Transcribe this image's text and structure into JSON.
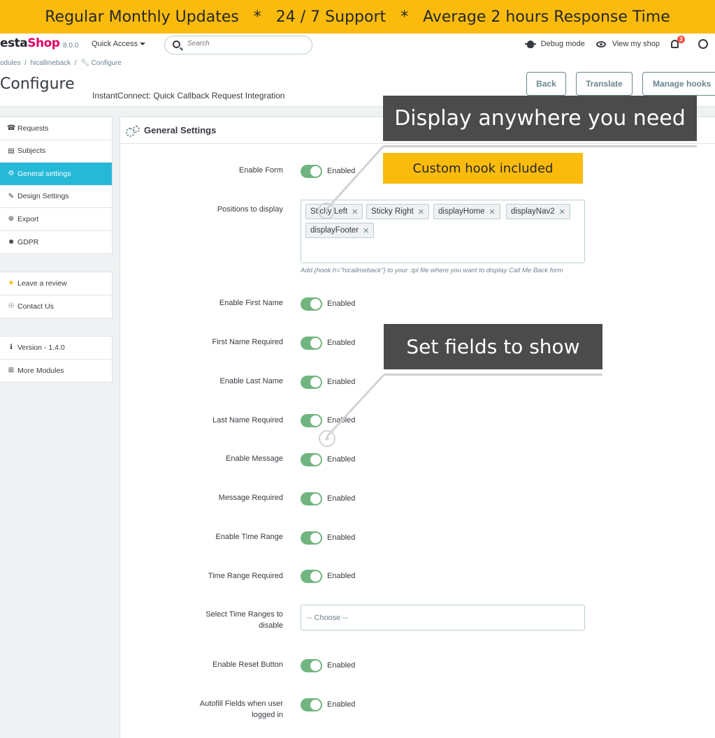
{
  "banner": {
    "text": "Regular Monthly Updates   *   24 / 7 Support   *   Average 2 hours Response Time"
  },
  "topbar": {
    "logo_prefix": "esta",
    "logo_suffix": "Shop",
    "version": "8.0.0",
    "quick_access": "Quick Access",
    "search_placeholder": "Search",
    "debug_mode": "Debug mode",
    "view_shop": "View my shop",
    "notifications_count": "3"
  },
  "header": {
    "breadcrumb": [
      "odules",
      "hicallmeback",
      "Configure"
    ],
    "title": "onfigure",
    "subtitle": "InstantConnect: Quick Callback Request Integration",
    "buttons": {
      "back": "Back",
      "translate": "Translate",
      "manage_hooks": "Manage hooks"
    }
  },
  "sidebar": {
    "main": [
      {
        "label": "Requests",
        "icon": "phone-icon"
      },
      {
        "label": "Subjects",
        "icon": "book-icon"
      },
      {
        "label": "General settings",
        "icon": "gear-icon",
        "active": true
      },
      {
        "label": "Design Settings",
        "icon": "brush-icon"
      },
      {
        "label": "Export",
        "icon": "export-icon"
      },
      {
        "label": "GDPR",
        "icon": "user-icon"
      }
    ],
    "support": [
      {
        "label": "Leave a review",
        "icon": "star-icon"
      },
      {
        "label": "Contact Us",
        "icon": "lifebuoy-icon"
      }
    ],
    "about": [
      {
        "label": "Version - 1.4.0",
        "icon": "info-icon"
      },
      {
        "label": "More Modules",
        "icon": "plus-square-icon"
      }
    ]
  },
  "panel": {
    "title": "General Settings",
    "enabled_label": "Enabled",
    "fields": {
      "enable_form": "Enable Form",
      "positions": "Positions to display",
      "enable_first_name": "Enable First Name",
      "first_name_required": "First Name Required",
      "enable_last_name": "Enable Last Name",
      "last_name_required": "Last Name Required",
      "enable_message": "Enable Message",
      "message_required": "Message Required",
      "enable_time_range": "Enable Time Range",
      "time_range_required": "Time Range Required",
      "select_time_ranges": "Select Time Ranges to disable",
      "enable_reset": "Enable Reset Button",
      "autofill": "Autofill Fields when user logged in"
    },
    "positions_tags": [
      "Sticky Left",
      "Sticky Right",
      "displayHome",
      "displayNav2",
      "displayFooter"
    ],
    "positions_help": "Add {hook h=\"hicallmeback\"} to your .tpl file where you want to display Call Me Back form",
    "time_ranges_placeholder": "-- Choose --"
  },
  "callouts": {
    "display_anywhere": "Display anywhere you need",
    "custom_hook": "Custom hook included",
    "set_fields": "Set fields to show"
  },
  "colors": {
    "banner": "#fbbb0c",
    "brand": "#df0067",
    "active": "#25b9d7",
    "toggle_on": "#70b580",
    "callout": "#4b4b4b"
  }
}
